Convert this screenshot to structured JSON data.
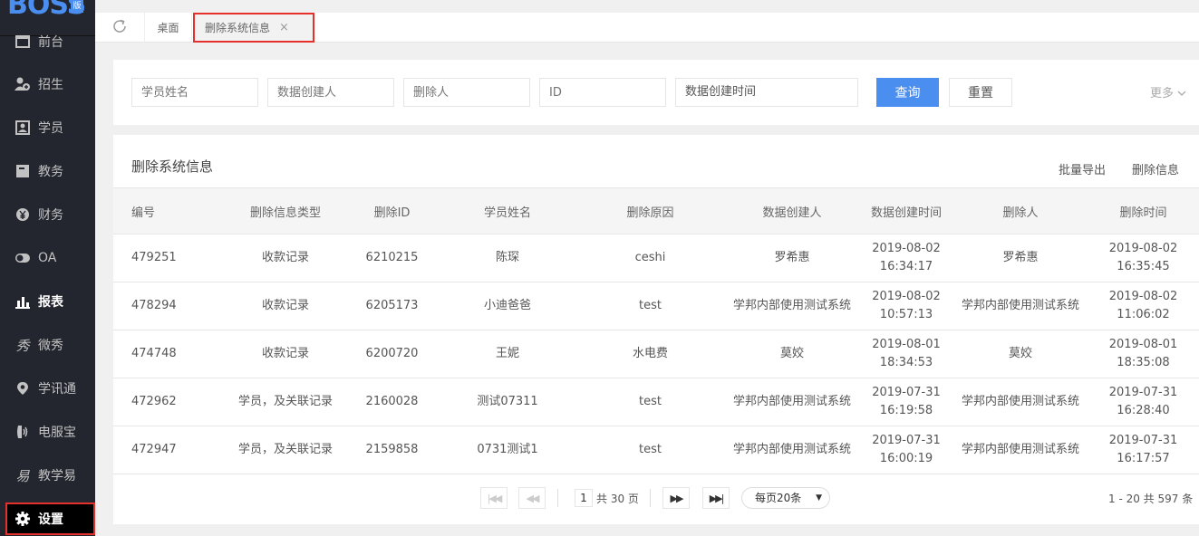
{
  "logo": {
    "text": "BOSS",
    "badge": "版"
  },
  "sidebar": {
    "items": [
      {
        "label": "前台",
        "icon": "monitor-icon"
      },
      {
        "label": "招生",
        "icon": "user-add-icon"
      },
      {
        "label": "学员",
        "icon": "id-card-icon"
      },
      {
        "label": "教务",
        "icon": "book-icon"
      },
      {
        "label": "财务",
        "icon": "yen-icon"
      },
      {
        "label": "OA",
        "icon": "toggle-icon"
      },
      {
        "label": "报表",
        "icon": "bar-chart-icon"
      },
      {
        "label": "微秀",
        "icon": "xiu-icon"
      },
      {
        "label": "学讯通",
        "icon": "location-icon"
      },
      {
        "label": "电服宝",
        "icon": "phone-icon"
      },
      {
        "label": "教学易",
        "icon": "teach-icon"
      },
      {
        "label": "设置",
        "icon": "gear-icon"
      }
    ]
  },
  "tabs": {
    "home": "桌面",
    "active": "删除系统信息",
    "close": "×"
  },
  "filters": {
    "student_name": "学员姓名",
    "creator": "数据创建人",
    "deleter": "删除人",
    "id": "ID",
    "created_time": "数据创建时间",
    "query": "查询",
    "reset": "重置",
    "more": "更多"
  },
  "card": {
    "title": "删除系统信息",
    "export": "批量导出",
    "delete_info": "删除信息"
  },
  "table": {
    "headers": [
      "编号",
      "删除信息类型",
      "删除ID",
      "学员姓名",
      "删除原因",
      "数据创建人",
      "数据创建时间",
      "删除人",
      "删除时间"
    ],
    "rows": [
      [
        "479251",
        "收款记录",
        "6210215",
        "陈琛",
        "ceshi",
        "罗希惠",
        "2019-08-02 16:34:17",
        "罗希惠",
        "2019-08-02 16:35:45"
      ],
      [
        "478294",
        "收款记录",
        "6205173",
        "小迪爸爸",
        "test",
        "学邦内部使用测试系统",
        "2019-08-02 10:57:13",
        "学邦内部使用测试系统",
        "2019-08-02 11:06:02"
      ],
      [
        "474748",
        "收款记录",
        "6200720",
        "王妮",
        "水电费",
        "莫姣",
        "2019-08-01 18:34:53",
        "莫姣",
        "2019-08-01 18:35:08"
      ],
      [
        "472962",
        "学员，及关联记录",
        "2160028",
        "测试07311",
        "test",
        "学邦内部使用测试系统",
        "2019-07-31 16:19:58",
        "学邦内部使用测试系统",
        "2019-07-31 16:28:40"
      ],
      [
        "472947",
        "学员，及关联记录",
        "2159858",
        "0731测试1",
        "test",
        "学邦内部使用测试系统",
        "2019-07-31 16:00:19",
        "学邦内部使用测试系统",
        "2019-07-31 16:17:57"
      ]
    ]
  },
  "pagination": {
    "page": "1",
    "total_pages": "共 30 页",
    "page_size": "每页20条",
    "range": "1 - 20   共 597 条"
  },
  "colors": {
    "accent": "#4a8ef0",
    "sidebar_bg": "#23262e",
    "highlight": "#e5302c"
  }
}
